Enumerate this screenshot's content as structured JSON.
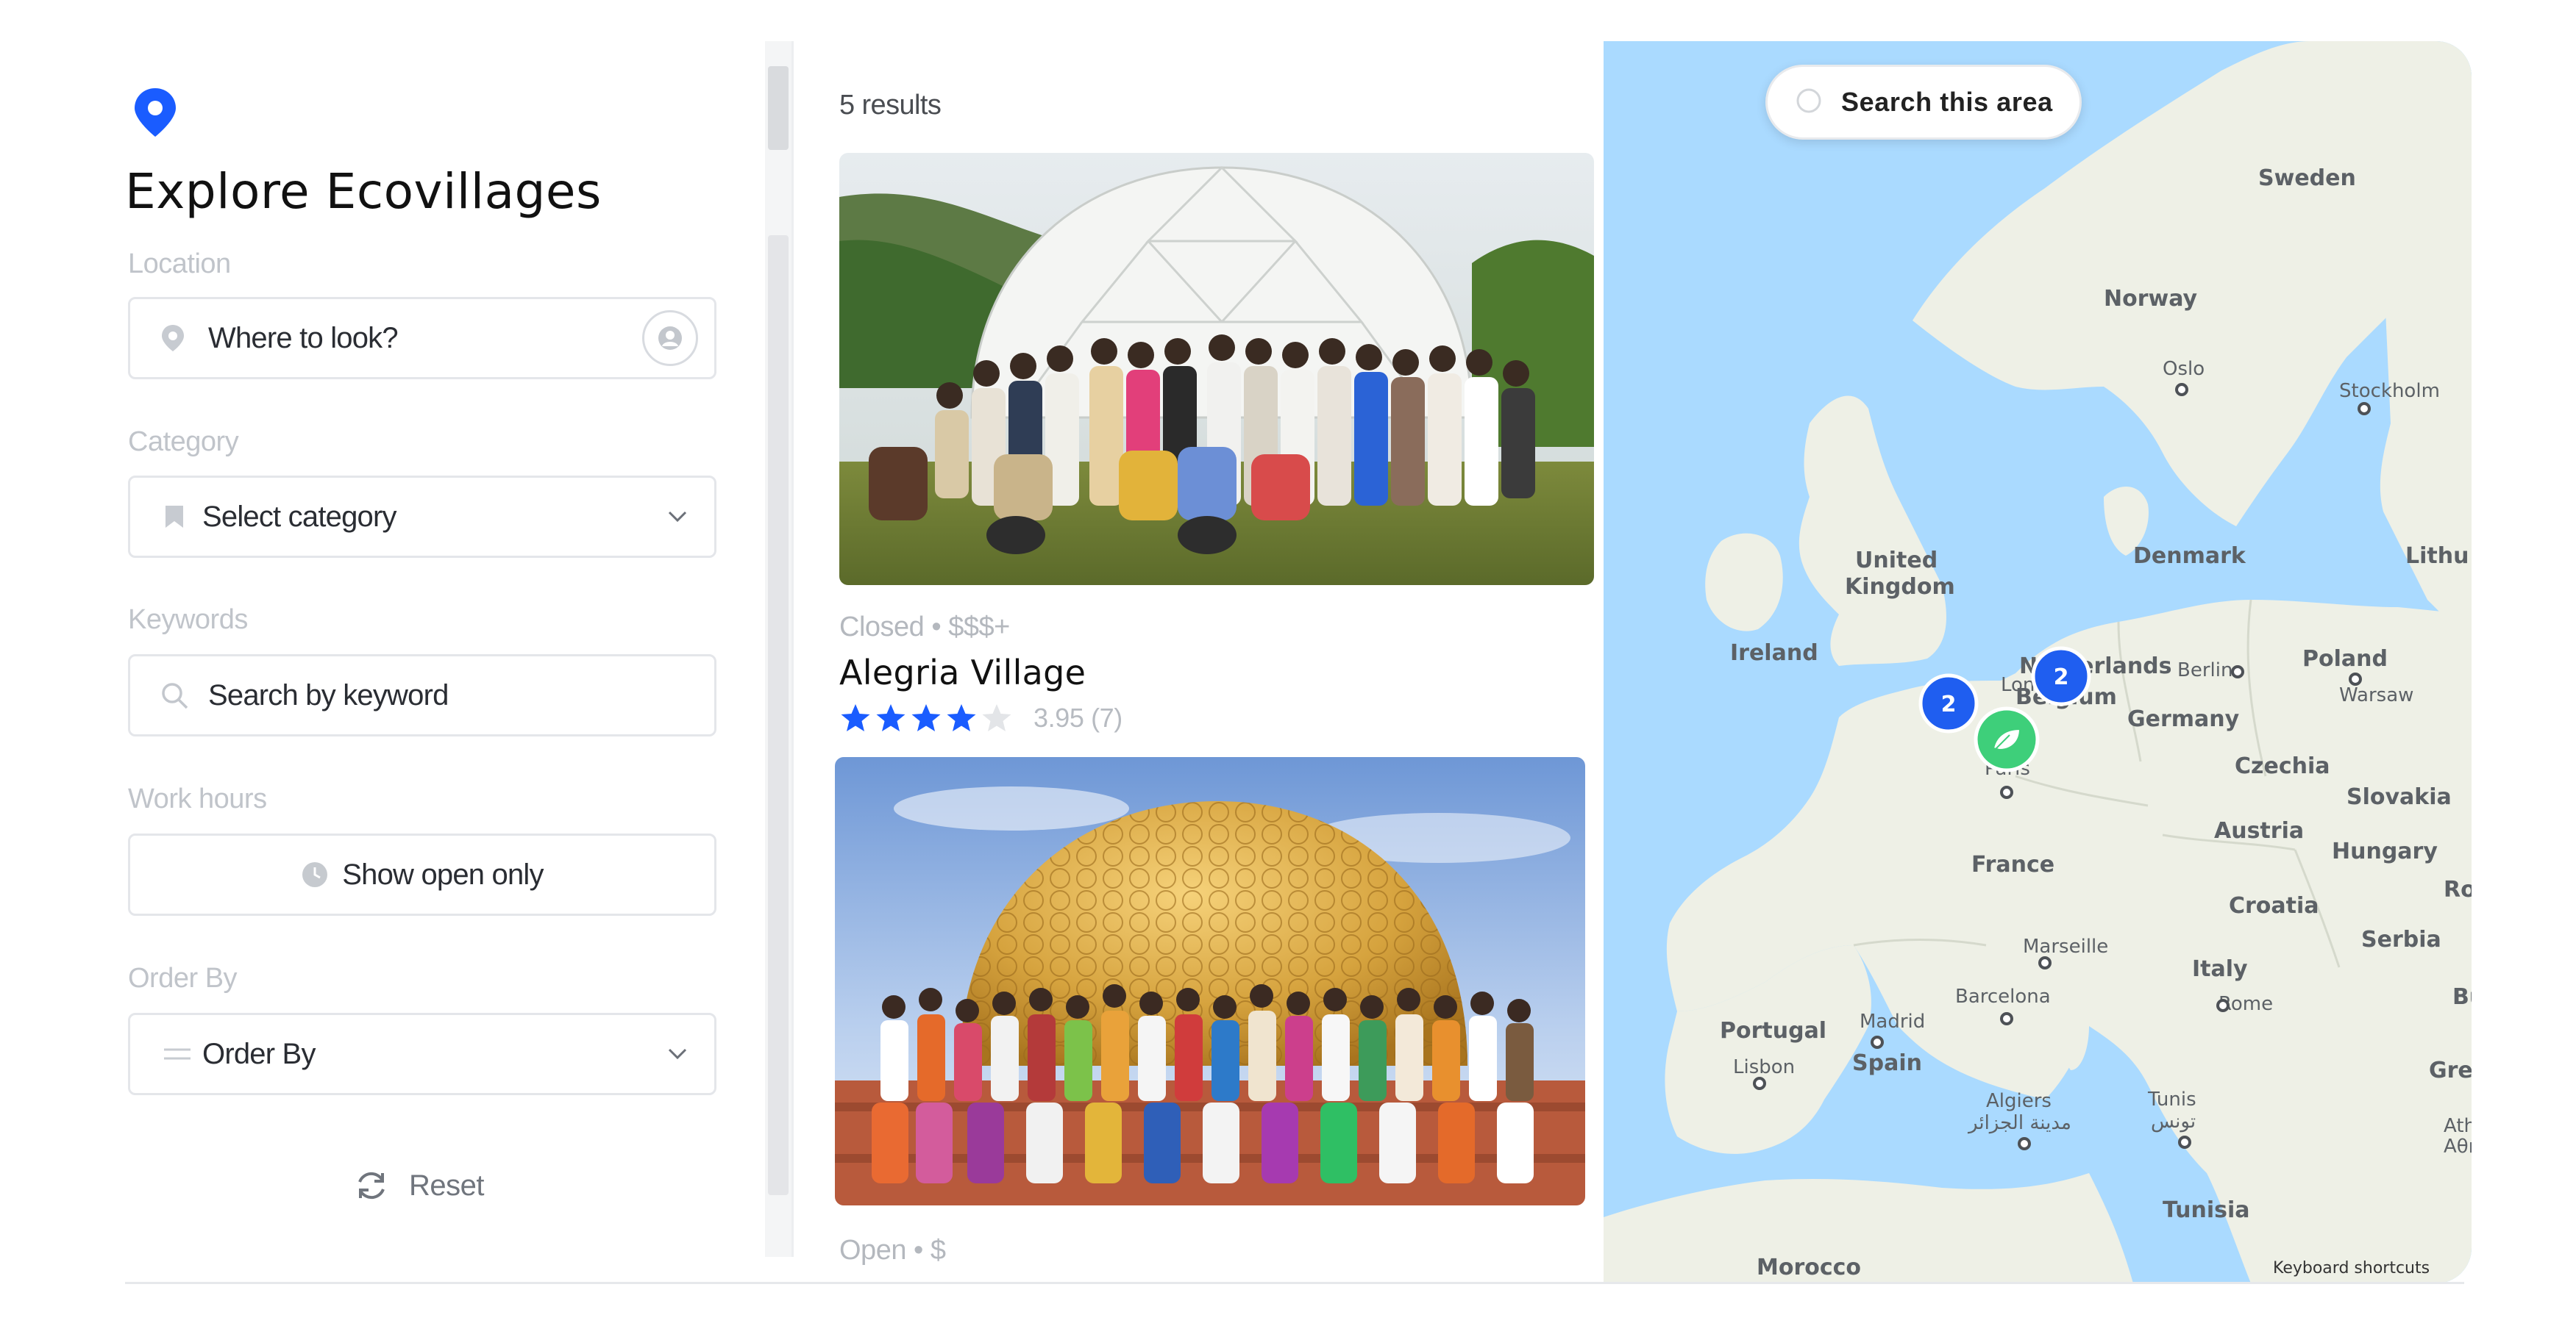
{
  "filters": {
    "title": "Explore Ecovillages",
    "location_label": "Location",
    "location_placeholder": "Where to look?",
    "category_label": "Category",
    "category_value": "Select category",
    "keywords_label": "Keywords",
    "keywords_placeholder": "Search by keyword",
    "workhours_label": "Work hours",
    "workhours_button": "Show open only",
    "orderby_label": "Order By",
    "orderby_value": "Order By",
    "reset_label": "Reset"
  },
  "results": {
    "count_label": "5 results",
    "cards": [
      {
        "status": "Closed • $$$+",
        "title": "Alegria Village",
        "rating_text": "3.95 (7)",
        "stars": 3.95
      },
      {
        "status": "Open • $"
      }
    ]
  },
  "map": {
    "search_area_label": "Search this area",
    "cluster_counts": [
      "2",
      "2"
    ],
    "attribution": "Keyboard shortcuts",
    "labels": {
      "sweden": "Sweden",
      "norway": "Norway",
      "oslo": "Oslo",
      "stockholm": "Stockholm",
      "denmark": "Denmark",
      "lithu": "Lithu",
      "united_kingdom_1": "United",
      "united_kingdom_2": "Kingdom",
      "ireland": "Ireland",
      "netherlands": "Netherlands",
      "london": "London",
      "berlin": "Berlin",
      "poland": "Poland",
      "warsaw": "Warsaw",
      "belgium": "Belgium",
      "germany": "Germany",
      "paris": "Paris",
      "czechia": "Czechia",
      "slovakia": "Slovakia",
      "austria": "Austria",
      "hungary": "Hungary",
      "france": "France",
      "ro": "Ro",
      "croatia": "Croatia",
      "serbia": "Serbia",
      "marseille": "Marseille",
      "italy": "Italy",
      "rome": "Rome",
      "bu": "Bu",
      "barcelona": "Barcelona",
      "portugal": "Portugal",
      "madrid": "Madrid",
      "spain": "Spain",
      "lisbon": "Lisbon",
      "greece": "Greec",
      "athens": "Athe",
      "athens_greek": "Αθήν",
      "algiers": "Algiers",
      "algiers_ar": "مدينة الجزائر",
      "tunis": "Tunis",
      "tunis_ar": "تونس",
      "tunisia": "Tunisia",
      "morocco": "Morocco"
    }
  },
  "colors": {
    "accent_blue": "#1a5cff",
    "cluster_blue": "#1f5ef0",
    "marker_green": "#3ecf7a",
    "water": "#aadaff",
    "land": "#eef0e6"
  },
  "icons": [
    "map-pin-icon",
    "locate-user-icon",
    "bookmark-icon",
    "chevron-down-icon",
    "search-icon",
    "clock-icon",
    "order-lines-icon",
    "refresh-icon",
    "star-icon",
    "leaf-icon"
  ]
}
